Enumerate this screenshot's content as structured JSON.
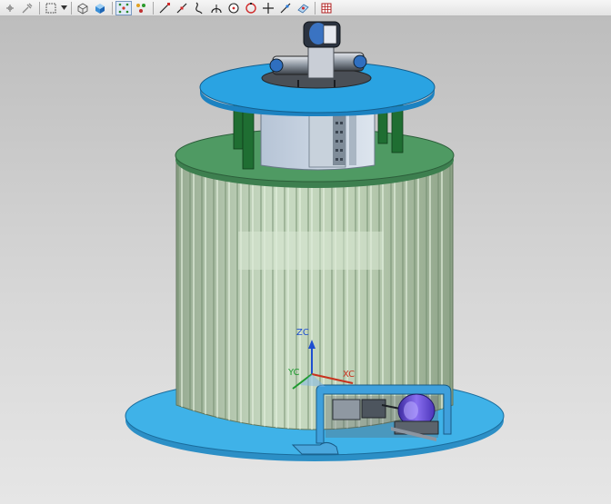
{
  "toolbar": {
    "buttons": [
      {
        "name": "snap-point-icon",
        "active": false
      },
      {
        "name": "snap-options-icon",
        "active": false
      },
      {
        "name": "selection-box-icon",
        "active": false
      },
      {
        "name": "wireframe-view-icon",
        "active": false
      },
      {
        "name": "shaded-view-icon",
        "active": false
      },
      {
        "name": "point-filter-icon",
        "active": true
      },
      {
        "name": "snap-grid-icon",
        "active": false
      },
      {
        "name": "end-point-icon",
        "active": false
      },
      {
        "name": "mid-point-icon",
        "active": false
      },
      {
        "name": "curve-point-icon",
        "active": false
      },
      {
        "name": "arc-center-icon",
        "active": false
      },
      {
        "name": "circle-center-icon",
        "active": false
      },
      {
        "name": "quadrant-point-icon",
        "active": false
      },
      {
        "name": "intersection-point-icon",
        "active": false
      },
      {
        "name": "point-on-curve-icon",
        "active": false
      },
      {
        "name": "point-on-face-icon",
        "active": false
      },
      {
        "name": "grid-view-icon",
        "active": false
      }
    ]
  },
  "triad": {
    "z_label": "ZC",
    "y_label": "YC",
    "x_label": "XC"
  },
  "colors": {
    "viewport_top": "#bdbdbd",
    "viewport_bottom": "#e6e6e6",
    "base_plate": "#3fb2e8",
    "cylinder_body": "#b9cdb1",
    "green_plate": "#4f9a63",
    "top_plate": "#2aa3e2",
    "columns": "#1f6e32",
    "motor": "#6d4fd0"
  }
}
